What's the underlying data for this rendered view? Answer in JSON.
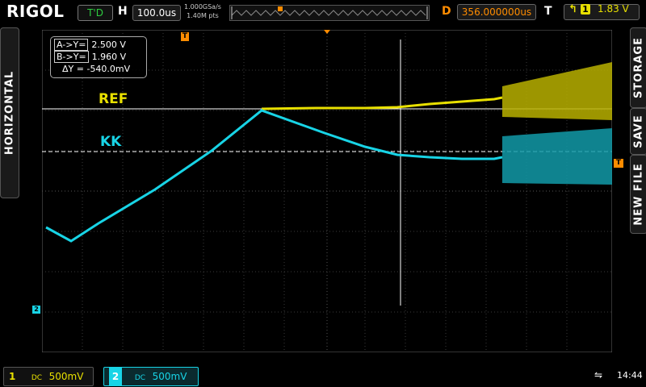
{
  "brand": "RIGOL",
  "top": {
    "run_status": "T'D",
    "timebase_label": "H",
    "timebase": "100.0us",
    "sample_rate": "1.000GSa/s",
    "memory_depth": "1.40M pts",
    "delay_label": "D",
    "delay": "356.000000us",
    "trigger_label": "T",
    "trigger_slope": "↰",
    "trigger_source": "1",
    "trigger_level": "1.83 V"
  },
  "side_menu": {
    "left_tab": "HORIZONTAL",
    "storage": "STORAGE",
    "save": "SAVE",
    "new_file": "NEW FILE"
  },
  "cursor": {
    "a_tag": "A->Y=",
    "a_value": "2.500 V",
    "b_tag": "B->Y=",
    "b_value": "1.960 V",
    "delta_tag": "ΔY =",
    "delta_value": "-540.0mV"
  },
  "annotations": {
    "ref": "REF",
    "kk": "KK"
  },
  "markers": {
    "trigger_marker": "T",
    "ch2_marker": "2",
    "trig_level_marker": "T"
  },
  "channels": [
    {
      "num": "1",
      "coupling": "DC",
      "scale": "500mV",
      "color": "#e8e000"
    },
    {
      "num": "2",
      "coupling": "DC",
      "scale": "500mV",
      "color": "#18d4e6"
    }
  ],
  "status": {
    "time": "14:44",
    "usb_icon": "usb-icon"
  },
  "colors": {
    "ch1": "#e8e000",
    "ch2": "#18d4e6",
    "accent": "#ff8c00"
  }
}
